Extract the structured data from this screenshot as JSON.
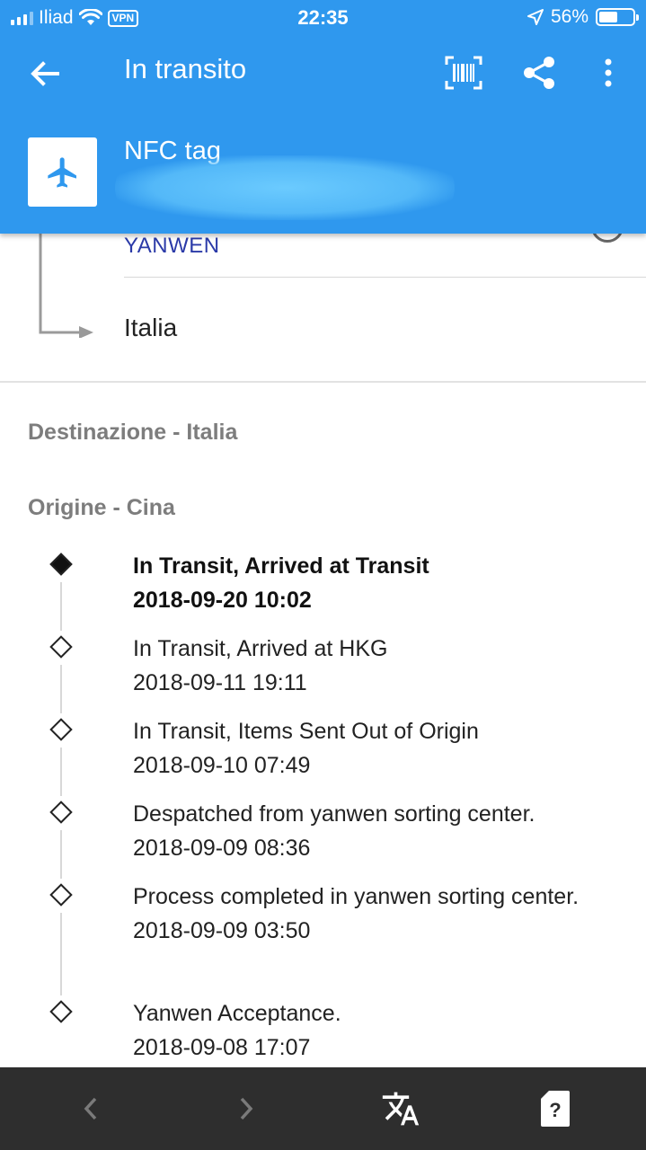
{
  "status_bar": {
    "carrier": "Iliad",
    "vpn": "VPN",
    "time": "22:35",
    "battery": "56%"
  },
  "toolbar": {
    "title": "In transito"
  },
  "package": {
    "name": "NFC tag",
    "icon": "airplane-icon"
  },
  "route": {
    "carrier": "YANWEN",
    "destination_country": "Italia"
  },
  "sections": {
    "destination": "Destinazione - Italia",
    "origin": "Origine - Cina"
  },
  "events": [
    {
      "status": "In Transit, Arrived at Transit",
      "date": "2018-09-20 10:02",
      "latest": true
    },
    {
      "status": "In Transit, Arrived at HKG",
      "date": "2018-09-11 19:11",
      "latest": false
    },
    {
      "status": "In Transit, Items Sent Out of Origin",
      "date": "2018-09-10 07:49",
      "latest": false
    },
    {
      "status": "Despatched from yanwen sorting center.",
      "date": "2018-09-09 08:36",
      "latest": false
    },
    {
      "status": "Process completed in yanwen sorting center.",
      "date": "2018-09-09 03:50",
      "latest": false
    },
    {
      "status": "Yanwen Acceptance.",
      "date": "2018-09-08 17:07",
      "latest": false
    }
  ],
  "colors": {
    "primary": "#2f98ee",
    "carrier_text": "#2b3aa8",
    "bottom_bar": "#2e2e2e"
  }
}
